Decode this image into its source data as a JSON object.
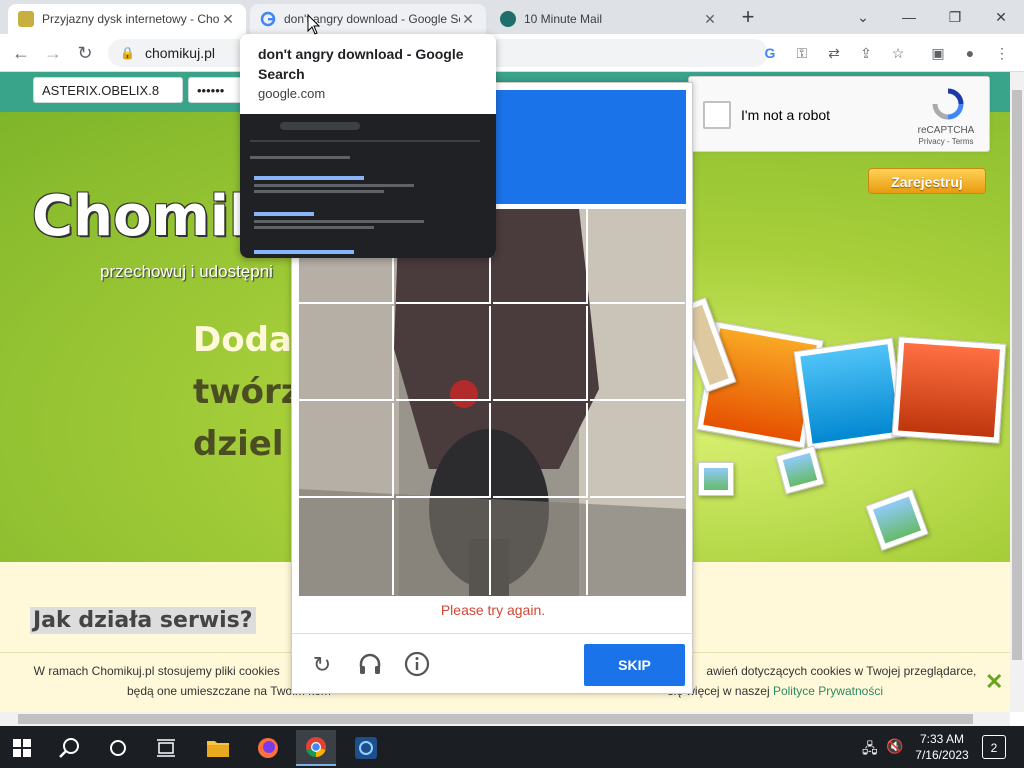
{
  "browser": {
    "tabs": [
      {
        "title": "Przyjazny dysk internetowy - Chomikuj.pl",
        "icon": "chomikuj-favicon"
      },
      {
        "title": "don't angry download - Google Search",
        "icon": "google-favicon"
      },
      {
        "title": "10 Minute Mail",
        "icon": "10minutemail-favicon"
      }
    ],
    "new_tab_symbol": "+",
    "close_symbol": "✕",
    "url": "chomikuj.pl"
  },
  "hovercard": {
    "title": "don't angry download - Google Search",
    "domain": "google.com"
  },
  "site": {
    "login_value": "ASTERIX.OBELIX.8",
    "password_mask": "••••••",
    "logo_text": "Chomiku",
    "tagline": "przechowuj i udostępni",
    "headline_1": "Dodaw",
    "headline_2": "twórz",
    "headline_3": "dziel s",
    "register_label": "Zarejestruj",
    "how_heading": "Jak działa serwis?"
  },
  "recaptcha": {
    "label": "I'm not a robot",
    "brand": "reCAPTCHA",
    "links": "Privacy - Terms"
  },
  "challenge": {
    "error_text": "Please try again.",
    "skip_label": "SKIP"
  },
  "cookie": {
    "text_line1_a": "W ramach Chomikuj.pl stosujemy pliki cookies",
    "text_line1_b": "awień dotyczących cookies w Twojej przeglądarce,",
    "text_line2_a": "będą one umieszczane na Twoim kom",
    "text_line2_b": "się więcej w naszej",
    "link_text": "Polityce Prywatności"
  },
  "taskbar": {
    "time": "7:33 AM",
    "date": "7/16/2023",
    "notifications": "2"
  },
  "colors": {
    "accent_blue": "#1a73e8",
    "site_green": "#a7cf3a",
    "error_red": "#d14836"
  }
}
